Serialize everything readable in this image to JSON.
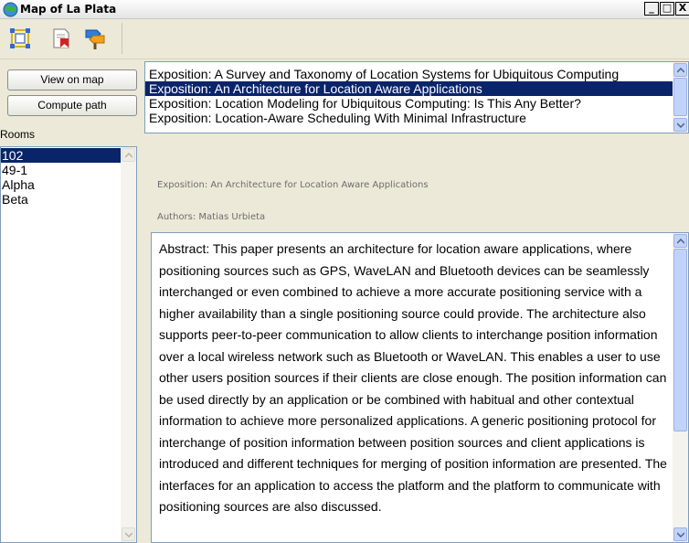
{
  "window": {
    "title": "Map of La Plata",
    "controls": {
      "minimize": "_",
      "maximize": "□",
      "close": "X"
    }
  },
  "toolbar": {
    "icons": [
      "select-area-icon",
      "document-bookmark-icon",
      "signpost-icon"
    ]
  },
  "left_panel": {
    "view_on_map_label": "View on map",
    "compute_path_label": "Compute path",
    "rooms_label": "Rooms",
    "rooms": [
      {
        "label": "102",
        "selected": true
      },
      {
        "label": "49-1",
        "selected": false
      },
      {
        "label": "Alpha",
        "selected": false
      },
      {
        "label": "Beta",
        "selected": false
      }
    ]
  },
  "expositions": [
    {
      "label": "Exposition: A Survey and Taxonomy of Location Systems for Ubiquitous Computing",
      "selected": false
    },
    {
      "label": "Exposition: An Architecture for Location Aware Applications",
      "selected": true
    },
    {
      "label": "Exposition: Location Modeling for Ubiquitous Computing: Is This Any Better?",
      "selected": false
    },
    {
      "label": "Exposition: Location-Aware Scheduling With Minimal Infrastructure",
      "selected": false
    }
  ],
  "details": {
    "exposition_line": "Exposition: An Architecture for Location Aware Applications",
    "authors_line": "Authors: Matias Urbieta",
    "abstract": "Abstract: This paper presents an architecture for location aware applications, where positioning sources such as GPS, WaveLAN and Bluetooth devices can be seamlessly interchanged or even combined to achieve a more accurate positioning service with a higher availability than a single positioning source could provide. The architecture also supports peer-to-peer communication to allow clients to interchange position information over a local wireless network such as Bluetooth or WaveLAN. This enables a user to use other users position sources if their clients are close enough. The position information can be used directly by an application or be combined with habitual and other contextual information to achieve more personalized applications. A generic positioning protocol for interchange of position information between position sources and client applications is introduced and different techniques for merging of position information are presented. The interfaces for an application to access the platform and the platform to communicate with positioning sources are also discussed."
  },
  "colors": {
    "selection": "#0a246a",
    "window_bg": "#ece9d8",
    "border": "#7f9db9"
  }
}
